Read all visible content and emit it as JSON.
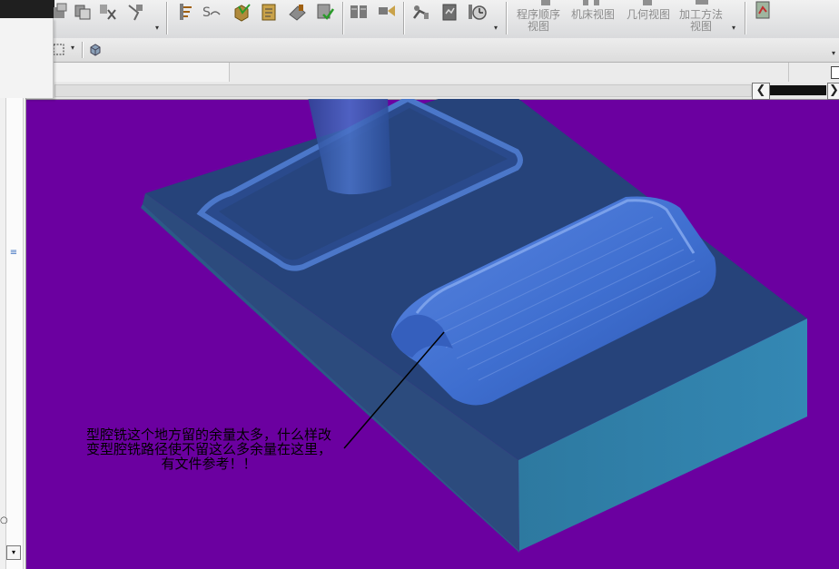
{
  "toolbar": {
    "icons": [
      "tool-icon",
      "tool-delete-icon",
      "tool-path-icon",
      "operation-icon",
      "stepper-icon",
      "cube-icon",
      "gauge-icon",
      "drill-icon",
      "generate-icon",
      "path-list-icon",
      "parallel-icon",
      "probe-icon",
      "robot-icon",
      "document-icon",
      "clock-icon"
    ],
    "views": [
      {
        "line1": "程序顺序",
        "line2": "视图"
      },
      {
        "line1": "机床视图",
        "line2": ""
      },
      {
        "line1": "几何视图",
        "line2": ""
      },
      {
        "line1": "加工方法",
        "line2": "视图"
      }
    ]
  },
  "annotation": {
    "line1": "型腔铣这个地方留的余量太多，什么样改",
    "line2": "变型腔铣路径使不留这么多余量在这里，",
    "line3": "有文件参考！！"
  },
  "colors": {
    "background": "#6b00a0",
    "part_top": "#26437a",
    "part_side_left": "#2c4b7d",
    "part_side_front": "#2f7fa6",
    "rib": "#3f6fd0"
  }
}
